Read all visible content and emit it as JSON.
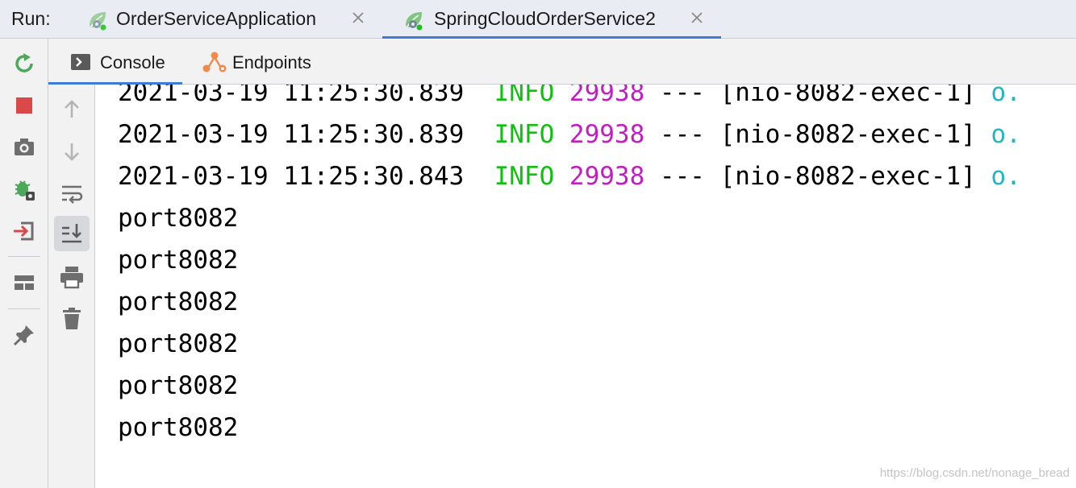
{
  "run_bar": {
    "label": "Run:",
    "tabs": [
      {
        "title": "OrderServiceApplication",
        "icon": "spring-boot-icon",
        "active": false
      },
      {
        "title": "SpringCloudOrderService2",
        "icon": "spring-boot-icon",
        "active": true
      }
    ]
  },
  "left_toolbar": [
    "rerun-icon",
    "stop-icon",
    "camera-icon",
    "debug-settings-icon",
    "exit-icon",
    "layout-icon",
    "pin-icon"
  ],
  "subtabs": [
    {
      "label": "Console",
      "icon": "console-icon",
      "active": true
    },
    {
      "label": "Endpoints",
      "icon": "endpoints-icon",
      "active": false
    }
  ],
  "console_toolbar": [
    "up-arrow-icon",
    "down-arrow-icon",
    "soft-wrap-icon",
    "scroll-to-end-icon",
    "print-icon",
    "trash-icon"
  ],
  "console": {
    "log_lines": [
      {
        "timestamp": "2021-03-19 11:25:30.839",
        "level": "INFO",
        "pid": "29938",
        "sep": "---",
        "thread": "[nio-8082-exec-1]",
        "logger": "o."
      },
      {
        "timestamp": "2021-03-19 11:25:30.839",
        "level": "INFO",
        "pid": "29938",
        "sep": "---",
        "thread": "[nio-8082-exec-1]",
        "logger": "o."
      },
      {
        "timestamp": "2021-03-19 11:25:30.843",
        "level": "INFO",
        "pid": "29938",
        "sep": "---",
        "thread": "[nio-8082-exec-1]",
        "logger": "o."
      }
    ],
    "output_lines": [
      "port8082",
      "port8082",
      "port8082",
      "port8082",
      "port8082",
      "port8082"
    ]
  },
  "colors": {
    "info": "#10c010",
    "pid": "#c11dc1",
    "logger": "#22b5c4",
    "accent": "#3d7bd6"
  },
  "watermark": "https://blog.csdn.net/nonage_bread"
}
